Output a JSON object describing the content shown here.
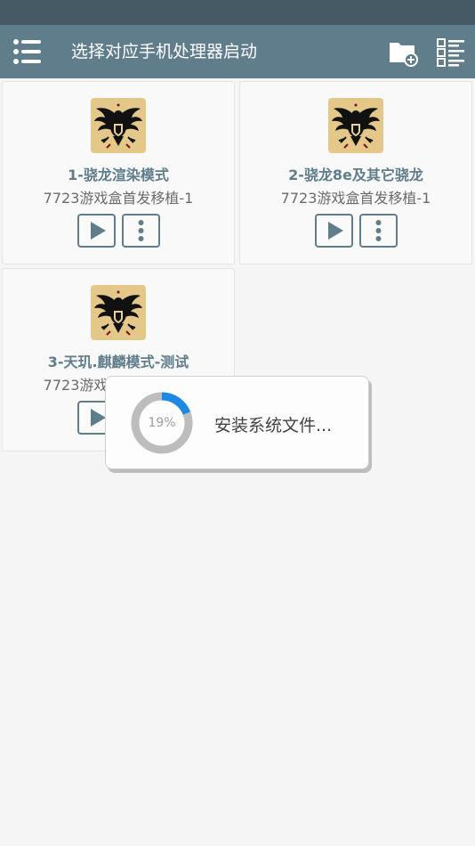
{
  "app_bar": {
    "title": "选择对应手机处理器启动",
    "menu_icon": "menu-icon",
    "add_folder_icon": "add-folder-icon",
    "list_view_icon": "list-view-icon"
  },
  "cards": [
    {
      "title": "1-骁龙渲染模式",
      "subtitle": "7723游戏盒首发移植-1",
      "image": "eagle-emblem"
    },
    {
      "title": "2-骁龙8e及其它骁龙",
      "subtitle": "7723游戏盒首发移植-1",
      "image": "eagle-emblem"
    },
    {
      "title": "3-天玑.麒麟模式-测试",
      "subtitle": "7723游戏盒首发移植-1",
      "image": "eagle-emblem"
    }
  ],
  "dialog": {
    "progress": 0.19,
    "progress_label": "19%",
    "message": "安装系统文件..."
  },
  "colors": {
    "status_bar": "#455a64",
    "app_bar": "#607d8b",
    "accent": "#1e88e5",
    "progress_track": "#bdbdbd"
  }
}
